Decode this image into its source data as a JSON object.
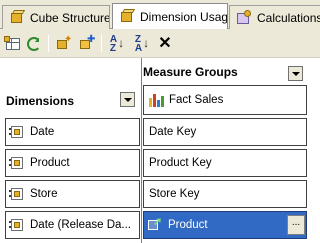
{
  "tabs": [
    {
      "label": "Cube Structure",
      "active": false
    },
    {
      "label": "Dimension Usage",
      "active": true
    },
    {
      "label": "Calculations",
      "active": false
    }
  ],
  "toolbar": {
    "buttons": [
      "add-cube-dimension-icon",
      "refresh-icon",
      "new-cube-icon",
      "cube-properties-icon",
      "sort-ascending-icon",
      "sort-descending-icon",
      "delete-icon"
    ],
    "sort_asc_letters": [
      "A",
      "Z"
    ],
    "sort_desc_letters": [
      "Z",
      "A"
    ],
    "sort_asc_arrow": "↓",
    "sort_desc_arrow": "↓",
    "delete_glyph": "✕"
  },
  "grid": {
    "measure_groups_header": "Measure Groups",
    "dimensions_header": "Dimensions",
    "measure_group": "Fact Sales",
    "dimensions": [
      "Date",
      "Product",
      "Store",
      "Date (Release Da..."
    ],
    "relationships": [
      "Date Key",
      "Product Key",
      "Store Key",
      "Product"
    ],
    "selected_relationship": "Product",
    "ellipsis_label": "..."
  },
  "colors": {
    "selection": "#316ac5",
    "chrome": "#ece9d8"
  }
}
